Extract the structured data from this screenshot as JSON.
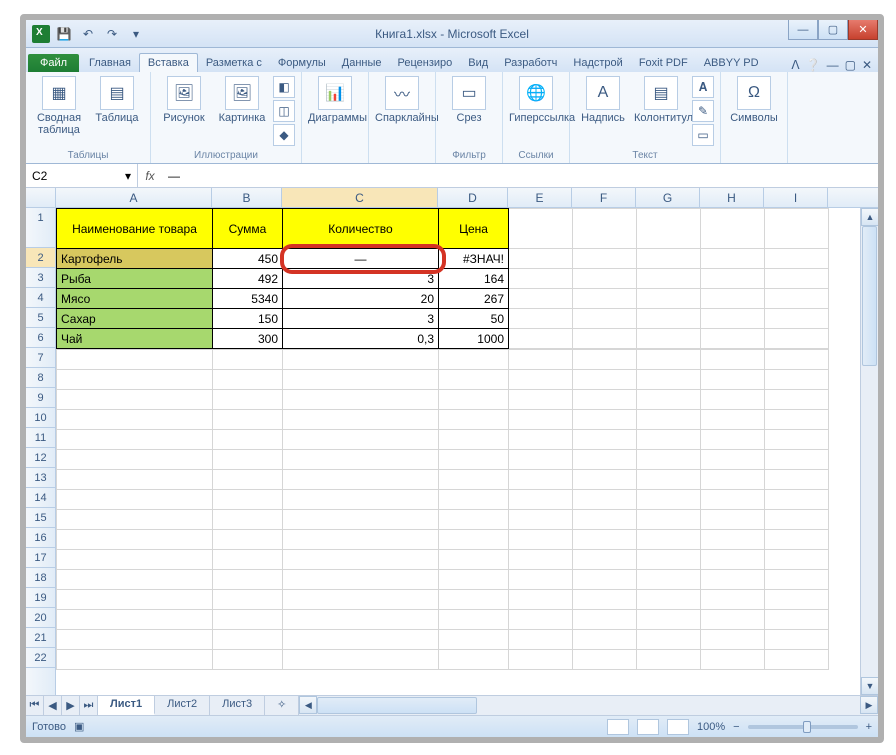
{
  "title": "Книга1.xlsx - Microsoft Excel",
  "qat": {
    "save": "💾",
    "undo": "↶",
    "redo": "↷"
  },
  "tabs": {
    "file": "Файл",
    "items": [
      "Главная",
      "Вставка",
      "Разметка с",
      "Формулы",
      "Данные",
      "Рецензиро",
      "Вид",
      "Разработч",
      "Надстрой",
      "Foxit PDF",
      "ABBYY PD"
    ],
    "active": "Вставка"
  },
  "ribbon": {
    "groups": [
      {
        "label": "Таблицы",
        "buttons": [
          "Сводная таблица",
          "Таблица"
        ]
      },
      {
        "label": "Иллюстрации",
        "buttons": [
          "Рисунок",
          "Картинка"
        ]
      },
      {
        "label": "",
        "buttons": [
          "Диаграммы"
        ]
      },
      {
        "label": "",
        "buttons": [
          "Спарклайны"
        ]
      },
      {
        "label": "Фильтр",
        "buttons": [
          "Срез"
        ]
      },
      {
        "label": "Ссылки",
        "buttons": [
          "Гиперссылка"
        ]
      },
      {
        "label": "Текст",
        "buttons": [
          "Надпись",
          "Колонтитулы"
        ]
      },
      {
        "label": "",
        "buttons": [
          "Символы"
        ]
      }
    ]
  },
  "namebox": "C2",
  "fx": "—",
  "columns": [
    "A",
    "B",
    "C",
    "D",
    "E",
    "F",
    "G",
    "H",
    "I"
  ],
  "headers": {
    "A": "Наименование товара",
    "B": "Сумма",
    "C": "Количество",
    "D": "Цена"
  },
  "rows": [
    {
      "name": "Картофель",
      "sum": "450",
      "qty": "—",
      "price": "#ЗНАЧ!"
    },
    {
      "name": "Рыба",
      "sum": "492",
      "qty": "3",
      "price": "164"
    },
    {
      "name": "Мясо",
      "sum": "5340",
      "qty": "20",
      "price": "267"
    },
    {
      "name": "Сахар",
      "sum": "150",
      "qty": "3",
      "price": "50"
    },
    {
      "name": "Чай",
      "sum": "300",
      "qty": "0,3",
      "price": "1000"
    }
  ],
  "sheets": {
    "items": [
      "Лист1",
      "Лист2",
      "Лист3"
    ],
    "active": "Лист1"
  },
  "status": {
    "ready": "Готово",
    "zoom": "100%"
  },
  "chart_data": {
    "type": "table",
    "columns": [
      "Наименование товара",
      "Сумма",
      "Количество",
      "Цена"
    ],
    "rows": [
      [
        "Картофель",
        450,
        "—",
        "#ЗНАЧ!"
      ],
      [
        "Рыба",
        492,
        3,
        164
      ],
      [
        "Мясо",
        5340,
        20,
        267
      ],
      [
        "Сахар",
        150,
        3,
        50
      ],
      [
        "Чай",
        300,
        0.3,
        1000
      ]
    ]
  }
}
